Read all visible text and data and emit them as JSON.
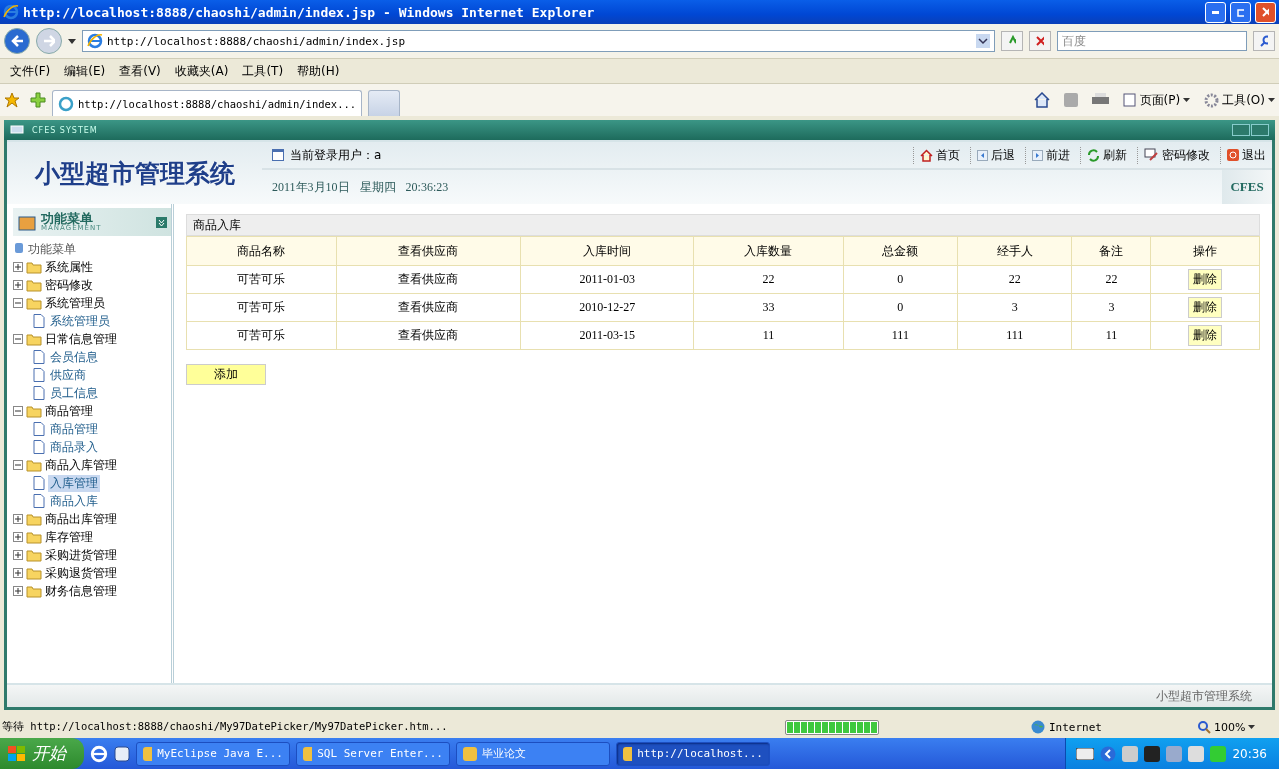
{
  "window": {
    "title": "http://localhost:8888/chaoshi/admin/index.jsp - Windows Internet Explorer"
  },
  "address_bar": {
    "value": "http://localhost:8888/chaoshi/admin/index.jsp",
    "search_placeholder": "百度"
  },
  "menu_bar": [
    "文件(F)",
    "编辑(E)",
    "查看(V)",
    "收藏夹(A)",
    "工具(T)",
    "帮助(H)"
  ],
  "tabs": [
    {
      "label": "http://localhost:8888/chaoshi/admin/index...",
      "selected": true
    },
    {
      "selected": false
    }
  ],
  "command_bar": [
    "页面(P)",
    "工具(O)"
  ],
  "app": {
    "frame_title": "CFES SYSTEM",
    "title": "小型超市管理系统",
    "user": "当前登录用户：a",
    "date": "2011年3月10日",
    "weekday": "星期四",
    "time": "20:36:23",
    "logo": "CFES",
    "nav": [
      {
        "kind": "home",
        "label": "首页"
      },
      {
        "kind": "back",
        "label": "后退"
      },
      {
        "kind": "forward",
        "label": "前进"
      },
      {
        "kind": "refresh",
        "label": "刷新"
      },
      {
        "kind": "password",
        "label": "密码修改"
      },
      {
        "kind": "exit",
        "label": "退出"
      }
    ],
    "sidebar": {
      "title": "功能菜单",
      "subtitle": "MANAGEMENT",
      "root": "功能菜单",
      "items": [
        {
          "label": "系统属性",
          "expanded": false
        },
        {
          "label": "密码修改",
          "expanded": false
        },
        {
          "label": "系统管理员",
          "expanded": true,
          "children": [
            {
              "label": "系统管理员",
              "selected": false
            }
          ]
        },
        {
          "label": "日常信息管理",
          "expanded": true,
          "children": [
            {
              "label": "会员信息",
              "selected": false
            },
            {
              "label": "供应商",
              "selected": false
            },
            {
              "label": "员工信息",
              "selected": false
            }
          ]
        },
        {
          "label": "商品管理",
          "expanded": true,
          "children": [
            {
              "label": "商品管理",
              "selected": false
            },
            {
              "label": "商品录入",
              "selected": false
            }
          ]
        },
        {
          "label": "商品入库管理",
          "expanded": true,
          "children": [
            {
              "label": "入库管理",
              "selected": true
            },
            {
              "label": "商品入库",
              "selected": false
            }
          ]
        },
        {
          "label": "商品出库管理",
          "expanded": false
        },
        {
          "label": "库存管理",
          "expanded": false
        },
        {
          "label": "采购进货管理",
          "expanded": false
        },
        {
          "label": "采购退货管理",
          "expanded": false
        },
        {
          "label": "财务信息管理",
          "expanded": false
        }
      ]
    },
    "panel": {
      "title": "商品入库",
      "columns": [
        "商品名称",
        "查看供应商",
        "入库时间",
        "入库数量",
        "总金额",
        "经手人",
        "备注",
        "操作"
      ],
      "rows": [
        {
          "name": "可苦可乐",
          "supplier": "查看供应商",
          "date": "2011-01-03",
          "quantity": "22",
          "amount": "0",
          "handler": "22",
          "note": "22",
          "action": "删除"
        },
        {
          "name": "可苦可乐",
          "supplier": "查看供应商",
          "date": "2010-12-27",
          "quantity": "33",
          "amount": "0",
          "handler": "3",
          "note": "3",
          "action": "删除"
        },
        {
          "name": "可苦可乐",
          "supplier": "查看供应商",
          "date": "2011-03-15",
          "quantity": "11",
          "amount": "111",
          "handler": "111",
          "note": "11",
          "action": "删除"
        }
      ],
      "add_button": "添加"
    },
    "footer": "小型超市管理系统"
  },
  "status_bar": {
    "text": "等待 http://localhost:8888/chaoshi/My97DatePicker/My97DatePicker.htm...",
    "progress": {
      "level": 1
    },
    "zone": "Internet",
    "zoom": "100%"
  },
  "taskbar": {
    "start": "开始",
    "tasks": [
      {
        "label": "MyEclipse Java E...",
        "selected": false
      },
      {
        "label": "SQL Server Enter...",
        "selected": false
      },
      {
        "label": "毕业论文",
        "selected": false
      },
      {
        "label": "http://localhost...",
        "selected": true
      }
    ],
    "clock": "20:36"
  }
}
